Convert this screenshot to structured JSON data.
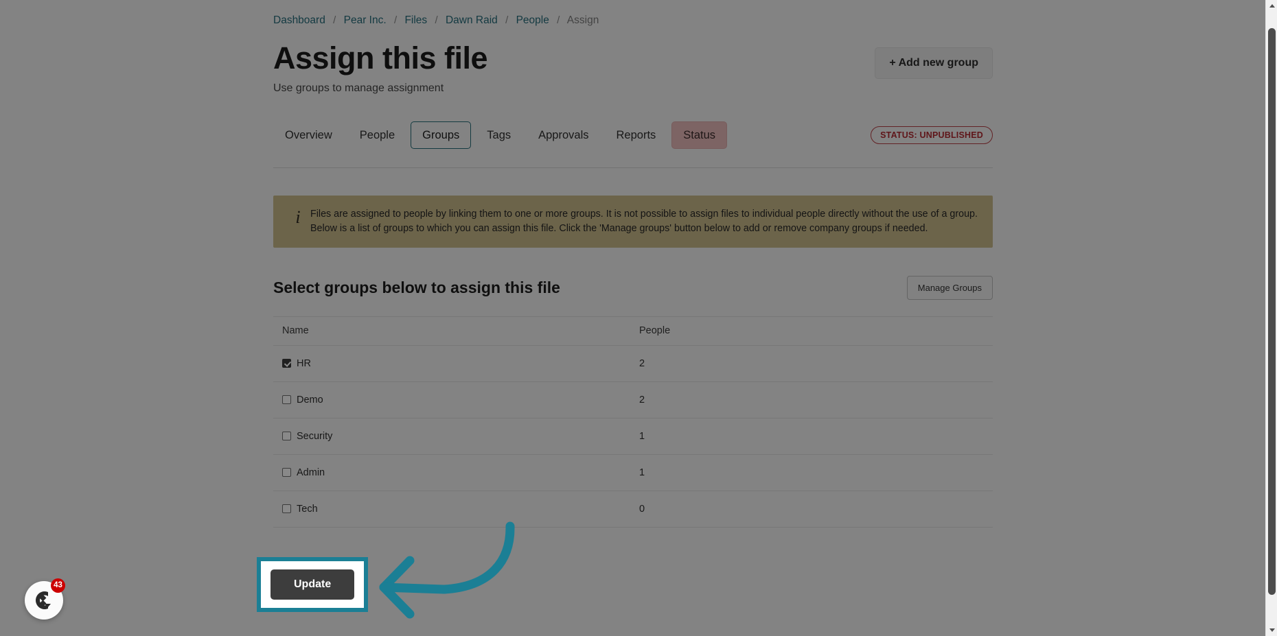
{
  "breadcrumb": {
    "items": [
      {
        "label": "Dashboard",
        "current": false
      },
      {
        "label": "Pear Inc.",
        "current": false
      },
      {
        "label": "Files",
        "current": false
      },
      {
        "label": "Dawn Raid",
        "current": false
      },
      {
        "label": "People",
        "current": false
      },
      {
        "label": "Assign",
        "current": true
      }
    ],
    "separator": "/"
  },
  "header": {
    "title": "Assign this file",
    "subtitle": "Use groups to manage assignment",
    "add_group_label": "+ Add new group"
  },
  "tabs": [
    {
      "label": "Overview",
      "state": "normal"
    },
    {
      "label": "People",
      "state": "normal"
    },
    {
      "label": "Groups",
      "state": "active"
    },
    {
      "label": "Tags",
      "state": "normal"
    },
    {
      "label": "Approvals",
      "state": "normal"
    },
    {
      "label": "Reports",
      "state": "normal"
    },
    {
      "label": "Status",
      "state": "status"
    }
  ],
  "status_badge": {
    "label": "STATUS: UNPUBLISHED",
    "color": "#b02a30"
  },
  "banner": {
    "icon": "info-italic-i",
    "text": "Files are assigned to people by linking them to one or more groups. It is not possible to assign files to individual people directly without the use of a group. Below is a list of groups to which you can assign this file. Click the 'Manage groups' button below to add or remove company groups if needed.",
    "background": "#c8b98a"
  },
  "section": {
    "title": "Select groups below to assign this file",
    "manage_groups_label": "Manage Groups"
  },
  "table": {
    "columns": [
      "Name",
      "People"
    ],
    "rows": [
      {
        "name": "HR",
        "people": "2",
        "checked": true
      },
      {
        "name": "Demo",
        "people": "2",
        "checked": false
      },
      {
        "name": "Security",
        "people": "1",
        "checked": false
      },
      {
        "name": "Admin",
        "people": "1",
        "checked": false
      },
      {
        "name": "Tech",
        "people": "0",
        "checked": false
      }
    ]
  },
  "actions": {
    "update_label": "Update",
    "highlight_color": "#1b7f95"
  },
  "annotation": {
    "arrow": "curved-left-arrow",
    "arrow_color": "#1b7f95"
  },
  "help_widget": {
    "icon": "chat-logo-icon",
    "badge_count": "43",
    "badge_color": "#cc0000"
  },
  "scrollbar": {
    "up_arrow": "chevron-up-icon",
    "down_arrow": "chevron-down-icon"
  }
}
